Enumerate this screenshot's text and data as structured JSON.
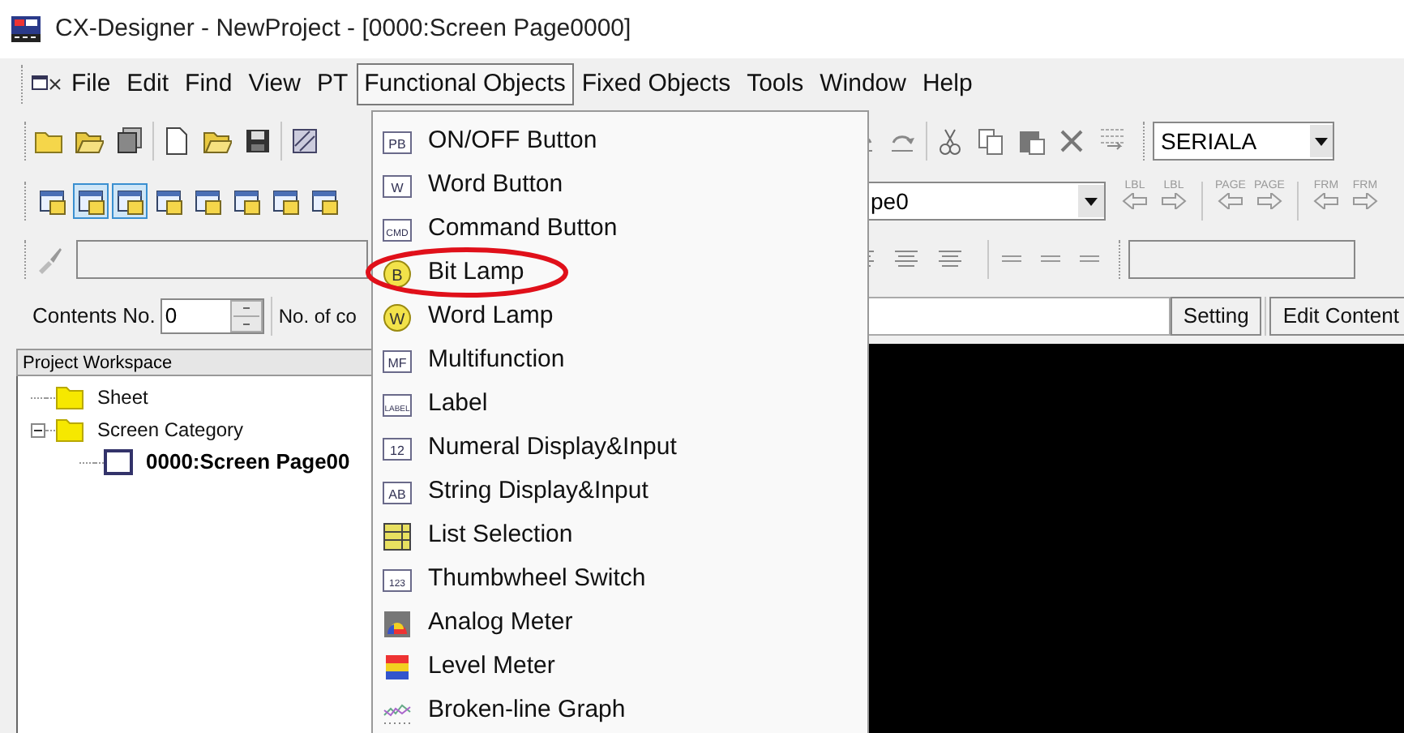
{
  "window": {
    "title": "CX-Designer - NewProject - [0000:Screen Page0000]"
  },
  "menu_bar": [
    {
      "label": "File",
      "selected": false
    },
    {
      "label": "Edit",
      "selected": false
    },
    {
      "label": "Find",
      "selected": false
    },
    {
      "label": "View",
      "selected": false
    },
    {
      "label": "PT",
      "selected": false
    },
    {
      "label": "Functional Objects",
      "selected": true
    },
    {
      "label": "Fixed Objects",
      "selected": false
    },
    {
      "label": "Tools",
      "selected": false
    },
    {
      "label": "Window",
      "selected": false
    },
    {
      "label": "Help",
      "selected": false
    }
  ],
  "toolbar": {
    "port_combo": "SERIALA",
    "type_combo": "pe0",
    "nav_buttons": [
      {
        "label": "LBL"
      },
      {
        "label": "LBL"
      },
      {
        "label": "PAGE"
      },
      {
        "label": "PAGE"
      },
      {
        "label": "FRM"
      },
      {
        "label": "FRM"
      }
    ]
  },
  "contents_bar": {
    "contents_label": "Contents No.",
    "contents_value": "0",
    "count_label": "No. of co",
    "buttons": [
      "Setting",
      "Edit Content"
    ]
  },
  "workspace": {
    "title": "Project Workspace",
    "tree": [
      {
        "label": "Sheet",
        "kind": "folder"
      },
      {
        "label": "Screen Category",
        "kind": "folder",
        "expanded": true,
        "children": [
          {
            "label": "0000:Screen Page00",
            "kind": "page"
          }
        ]
      }
    ]
  },
  "dropdown": {
    "items": [
      {
        "label": "ON/OFF Button",
        "kind": "badge",
        "icon": "PB",
        "circled": false
      },
      {
        "label": "Word Button",
        "kind": "badge",
        "icon": "W",
        "circled": false
      },
      {
        "label": "Command Button",
        "kind": "badge",
        "icon": "CMD",
        "circled": false
      },
      {
        "label": "Bit Lamp",
        "kind": "lamp",
        "icon": "B",
        "circled": true
      },
      {
        "label": "Word Lamp",
        "kind": "lamp",
        "icon": "W",
        "circled": false
      },
      {
        "label": "Multifunction",
        "kind": "badge",
        "icon": "MF",
        "circled": false
      },
      {
        "label": "Label",
        "kind": "badge",
        "icon": "LABEL",
        "circled": false
      },
      {
        "label": "Numeral Display&Input",
        "kind": "badge",
        "icon": "12",
        "circled": false
      },
      {
        "label": "String Display&Input",
        "kind": "badge",
        "icon": "AB",
        "circled": false
      },
      {
        "label": "List Selection",
        "kind": "list",
        "circled": false
      },
      {
        "label": "Thumbwheel Switch",
        "kind": "badge",
        "icon": "123",
        "circled": false
      },
      {
        "label": "Analog Meter",
        "kind": "meter",
        "circled": false
      },
      {
        "label": "Level Meter",
        "kind": "bars",
        "circled": false
      },
      {
        "label": "Broken-line Graph",
        "kind": "graph",
        "circled": false
      }
    ]
  }
}
